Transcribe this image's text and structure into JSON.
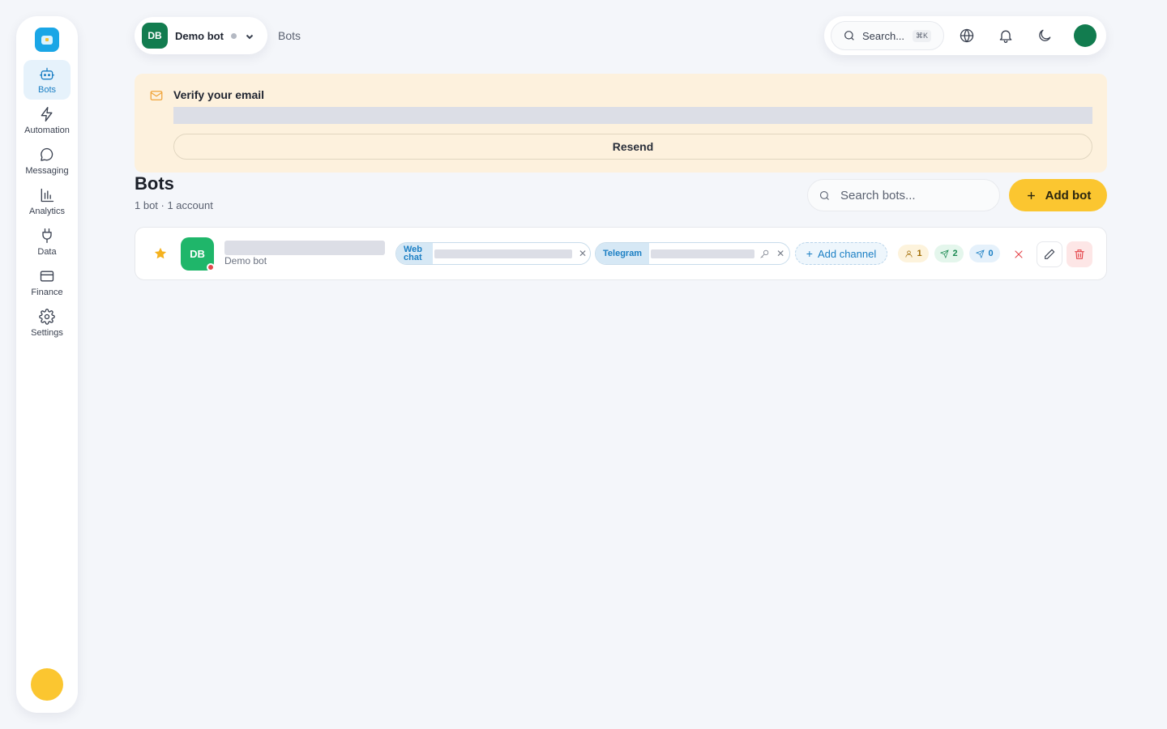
{
  "sidebar": {
    "items": [
      {
        "label": "Bots",
        "icon": "bot-icon",
        "active": true
      },
      {
        "label": "Automation",
        "icon": "lightning-icon"
      },
      {
        "label": "Messaging",
        "icon": "chat-bubble-icon"
      },
      {
        "label": "Analytics",
        "icon": "bar-chart-icon"
      },
      {
        "label": "Data",
        "icon": "plug-icon"
      },
      {
        "label": "Finance",
        "icon": "credit-card-icon"
      },
      {
        "label": "Settings",
        "icon": "gear-icon"
      }
    ]
  },
  "topbar": {
    "bot_initials": "DB",
    "bot_name": "Demo bot",
    "breadcrumb": "Bots",
    "search_label": "Search...",
    "search_shortcut": "⌘K"
  },
  "banner": {
    "title": "Verify your email",
    "resend_label": "Resend"
  },
  "page": {
    "title": "Bots",
    "subtitle": "1 bot · 1 account",
    "search_placeholder": "Search bots...",
    "add_label": "Add bot"
  },
  "bots": [
    {
      "initials": "DB",
      "name": "Demo bot",
      "channels": [
        {
          "label": "Web chat"
        },
        {
          "label": "Telegram"
        }
      ],
      "add_channel_label": "Add channel",
      "stats": {
        "users": "1",
        "sent": "2",
        "queued": "0"
      }
    }
  ],
  "colors": {
    "accent": "#fbc630",
    "primary_blue": "#1b7fc4",
    "brand_green": "#127c4f",
    "banner_bg": "#fdf1dd",
    "danger": "#e5484d"
  }
}
